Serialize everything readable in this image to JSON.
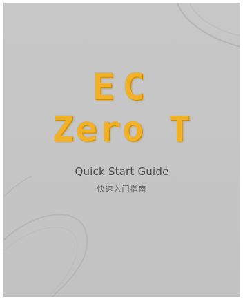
{
  "cover": {
    "brand_line_1": "EC",
    "brand_line_2": "Zero T",
    "subtitle_en": "Quick Start Guide",
    "subtitle_zh": "快速入门指南"
  },
  "colors": {
    "background": "#c6c6c6",
    "brand": "#f1b129",
    "text": "#4a4a4a"
  }
}
